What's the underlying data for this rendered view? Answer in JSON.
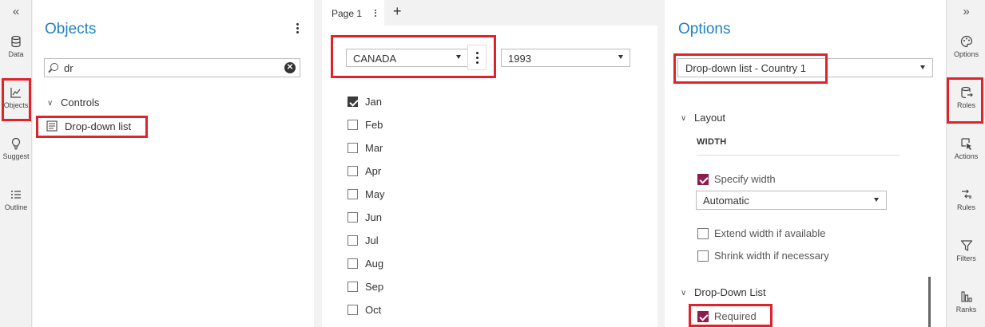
{
  "left_rail": {
    "collapse_glyph": "«",
    "items": [
      {
        "label": "Data",
        "icon": "database-icon"
      },
      {
        "label": "Objects",
        "icon": "line-chart-icon"
      },
      {
        "label": "Suggest",
        "icon": "lightbulb-icon"
      },
      {
        "label": "Outline",
        "icon": "outline-list-icon"
      }
    ]
  },
  "objects_pane": {
    "title": "Objects",
    "search_value": "dr",
    "clear_glyph": "✕",
    "tree": {
      "group_label": "Controls",
      "item_label": "Drop-down list"
    }
  },
  "canvas": {
    "page_tab_label": "Page 1",
    "add_page_glyph": "+",
    "country_dropdown": "CANADA",
    "year_dropdown": "1993",
    "months": [
      {
        "label": "Jan",
        "checked": true
      },
      {
        "label": "Feb",
        "checked": false
      },
      {
        "label": "Mar",
        "checked": false
      },
      {
        "label": "Apr",
        "checked": false
      },
      {
        "label": "May",
        "checked": false
      },
      {
        "label": "Jun",
        "checked": false
      },
      {
        "label": "Jul",
        "checked": false
      },
      {
        "label": "Aug",
        "checked": false
      },
      {
        "label": "Sep",
        "checked": false
      },
      {
        "label": "Oct",
        "checked": false
      }
    ]
  },
  "options_pane": {
    "title": "Options",
    "object_selector": "Drop-down list - Country 1",
    "layout_section": "Layout",
    "width_heading": "WIDTH",
    "specify_width_label": "Specify width",
    "specify_width_checked": true,
    "width_mode": "Automatic",
    "extend_width_label": "Extend width if available",
    "extend_width_checked": false,
    "shrink_width_label": "Shrink width if necessary",
    "shrink_width_checked": false,
    "dropdown_section": "Drop-Down List",
    "required_label": "Required",
    "required_checked": true
  },
  "right_rail": {
    "collapse_glyph": "»",
    "items": [
      {
        "label": "Options",
        "icon": "palette-icon"
      },
      {
        "label": "Roles",
        "icon": "roles-icon"
      },
      {
        "label": "Actions",
        "icon": "actions-icon"
      },
      {
        "label": "Rules",
        "icon": "rules-icon"
      },
      {
        "label": "Filters",
        "icon": "filter-icon"
      },
      {
        "label": "Ranks",
        "icon": "ranks-icon"
      }
    ]
  },
  "colors": {
    "accent_blue": "#1e82c4",
    "highlight_red": "#e0222b",
    "checked_maroon": "#8c1d4d"
  }
}
